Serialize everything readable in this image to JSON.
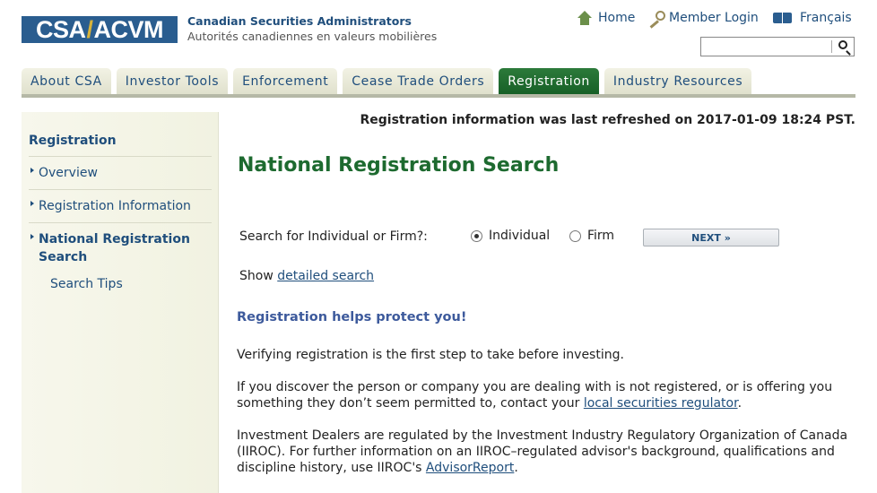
{
  "header": {
    "logo_left": "CSA",
    "logo_slash": "/",
    "logo_right": "ACVM",
    "org_name_en": "Canadian Securities Administrators",
    "org_name_fr": "Autorités canadiennes en valeurs mobilières",
    "links": {
      "home": "Home",
      "login": "Member Login",
      "french": "Français"
    },
    "search": {
      "value": "",
      "placeholder": ""
    },
    "colors": {
      "brand_blue": "#2a5d8f",
      "brand_gold": "#d8b33a"
    }
  },
  "nav": {
    "tabs": [
      {
        "label": "About CSA"
      },
      {
        "label": "Investor Tools"
      },
      {
        "label": "Enforcement"
      },
      {
        "label": "Cease Trade Orders"
      },
      {
        "label": "Registration",
        "active": true
      },
      {
        "label": "Industry Resources"
      }
    ],
    "active_color": "#1d6a2f"
  },
  "sidebar": {
    "title": "Registration",
    "items": [
      {
        "label": "Overview"
      },
      {
        "label": "Registration Information"
      },
      {
        "label": "National Registration Search",
        "line1": "National Registration",
        "line2": "Search",
        "current": true
      }
    ],
    "subitem": "Search Tips"
  },
  "main": {
    "refresh_notice": "Registration information was last refreshed on 2017-01-09 18:24 PST.",
    "title": "National Registration Search",
    "search_question": "Search for Individual or Firm?:",
    "options": [
      {
        "label": "Individual",
        "selected": true
      },
      {
        "label": "Firm",
        "selected": false
      }
    ],
    "next_button": "NEXT »",
    "show_prefix": "Show",
    "detailed_search_link": "detailed search",
    "help_title": "Registration helps protect you!",
    "para1": "Verifying registration is the first step to take before investing.",
    "para2_text": "If you discover the person or company you are dealing with is not registered, or is offering you something they don’t seem permitted to, contact your",
    "para2_link": "local securities regulator",
    "para2_end": ".",
    "para3_text": "Investment Dealers are regulated by the Investment Industry Regulatory Organization of Canada (IIROC). For further information on an IIROC–regulated advisor's background, qualifications and discipline history, use IIROC's",
    "para3_link": "AdvisorReport",
    "para3_end": "."
  }
}
